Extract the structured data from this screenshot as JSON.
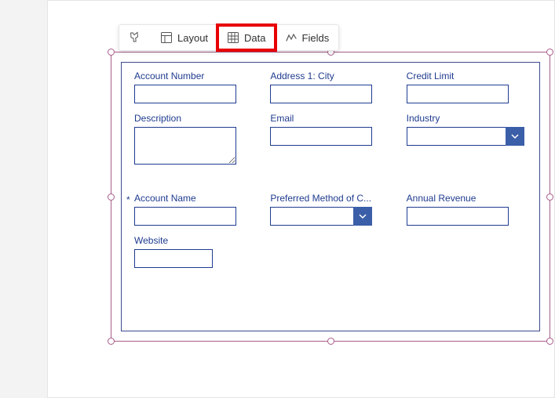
{
  "toolbar": {
    "layout_label": "Layout",
    "data_label": "Data",
    "fields_label": "Fields"
  },
  "fields": {
    "account_number": {
      "label": "Account Number"
    },
    "address1_city": {
      "label": "Address 1: City"
    },
    "credit_limit": {
      "label": "Credit Limit"
    },
    "description": {
      "label": "Description"
    },
    "email": {
      "label": "Email"
    },
    "industry": {
      "label": "Industry"
    },
    "account_name": {
      "label": "Account Name",
      "required_marker": "*"
    },
    "preferred_method": {
      "label": "Preferred Method of C..."
    },
    "annual_revenue": {
      "label": "Annual Revenue"
    },
    "website": {
      "label": "Website"
    }
  }
}
